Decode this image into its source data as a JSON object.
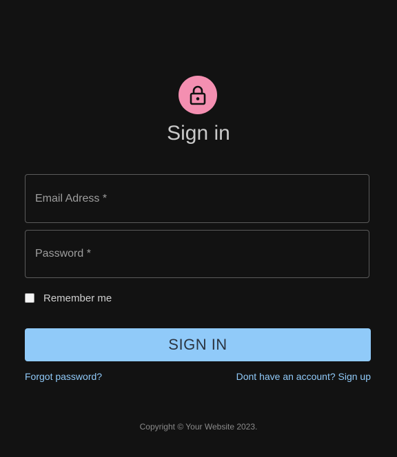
{
  "header": {
    "icon": "lock-icon",
    "title": "Sign in",
    "avatar_color": "#f48fb1"
  },
  "form": {
    "email_label": "Email Adress *",
    "email_value": "",
    "password_label": "Password *",
    "password_value": "",
    "remember_label": "Remember me",
    "remember_checked": false,
    "submit_label": "SIGN IN",
    "submit_color": "#90caf9"
  },
  "links": {
    "forgot": "Forgot password?",
    "signup": "Dont have an account? Sign up",
    "color": "#90caf9"
  },
  "footer": {
    "copyright": "Copyright © Your Website 2023."
  }
}
